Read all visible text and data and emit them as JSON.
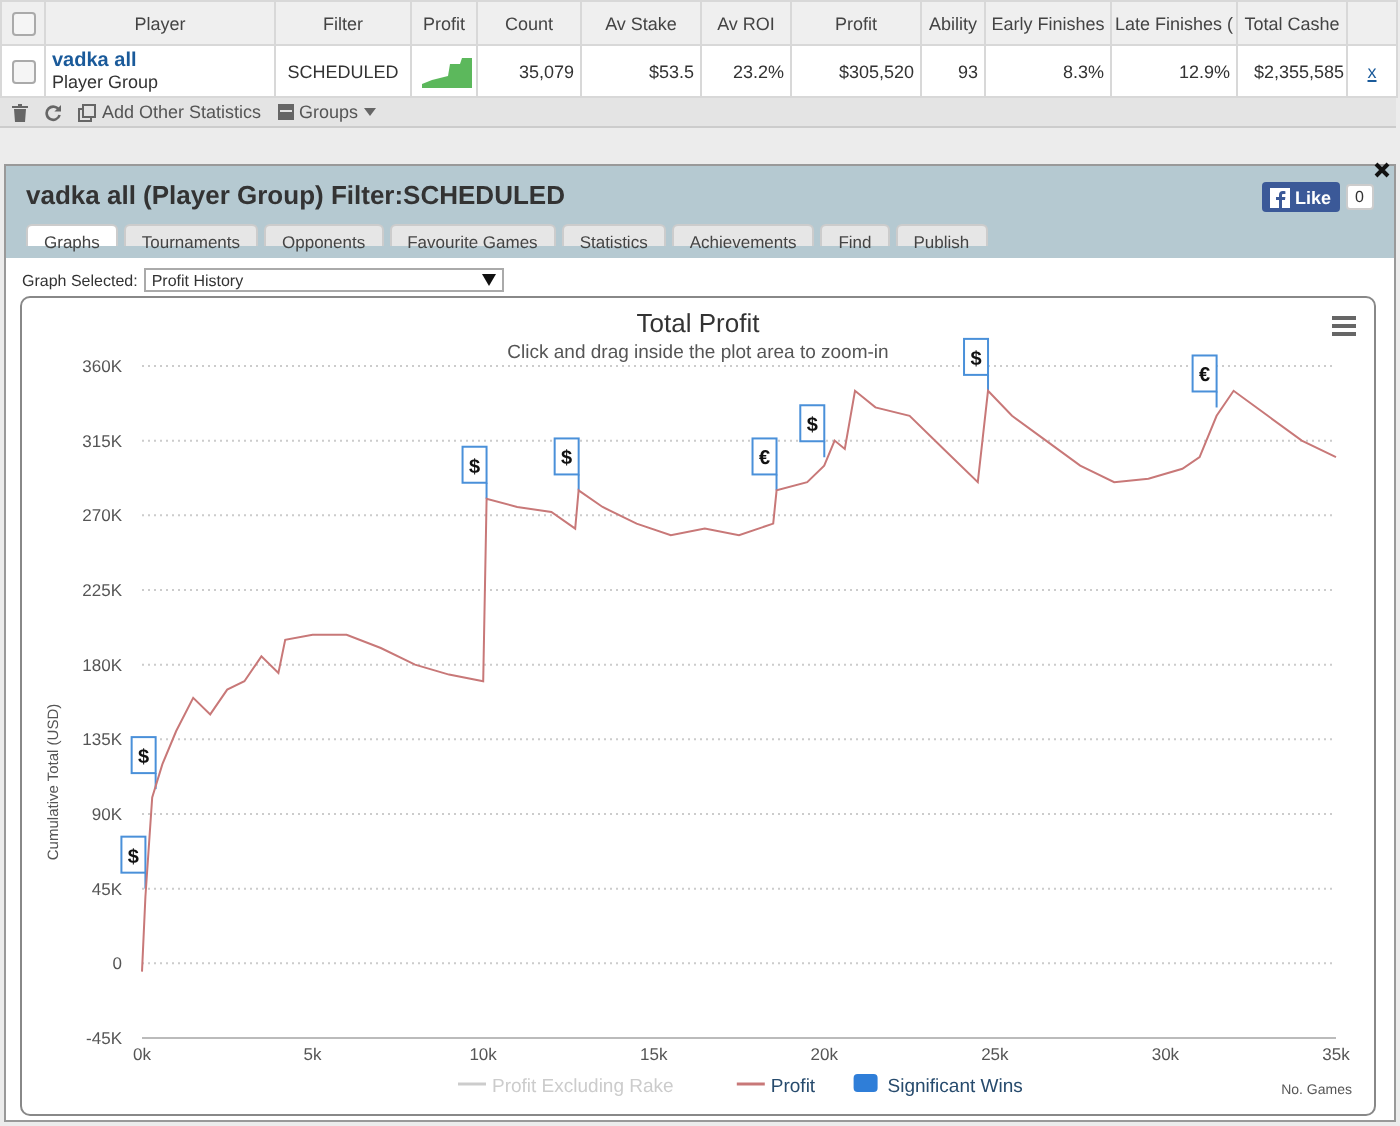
{
  "table": {
    "all_checked": false,
    "columns": [
      "Player",
      "Filter",
      "Profit",
      "Count",
      "Av Stake",
      "Av ROI",
      "Profit",
      "Ability",
      "Early Finishes",
      "Late Finishes (",
      "Total Cashe"
    ],
    "rows": [
      {
        "checked": false,
        "player": "vadka all",
        "player_type": "Player Group",
        "filter": "SCHEDULED",
        "count": "35,079",
        "av_stake": "$53.5",
        "av_roi": "23.2%",
        "profit": "$305,520",
        "ability": "93",
        "early_finishes": "8.3%",
        "late_finishes": "12.9%",
        "total_cashes": "$2,355,585",
        "remove": "x"
      }
    ]
  },
  "toolbar": {
    "items": [
      {
        "kind": "delete"
      },
      {
        "kind": "refresh"
      },
      {
        "kind": "add",
        "label": "Add Other Statistics"
      },
      {
        "kind": "groups",
        "label": "Groups"
      }
    ]
  },
  "panel": {
    "title": "vadka all (Player Group) Filter:SCHEDULED",
    "like": {
      "label": "Like",
      "count": "0"
    },
    "tabs": [
      {
        "label": "Graphs",
        "selected": true
      },
      {
        "label": "Tournaments",
        "selected": false
      },
      {
        "label": "Opponents",
        "selected": false
      },
      {
        "label": "Favourite Games",
        "selected": false
      },
      {
        "label": "Statistics",
        "selected": false
      },
      {
        "label": "Achievements",
        "selected": false
      },
      {
        "label": "Find",
        "selected": false
      },
      {
        "label": "Publish",
        "selected": false
      }
    ],
    "graph_select": {
      "label": "Graph Selected:",
      "value": "Profit History"
    },
    "chart": {
      "subtitle": "Click and drag inside the plot area to zoom-in",
      "legend": [
        {
          "label": "Profit Excluding Rake",
          "hidden": true,
          "color": "#cccccc",
          "kind": "line"
        },
        {
          "hidden": false,
          "kind": "series"
        },
        {
          "label": "Significant Wins",
          "hidden": false,
          "color": "#2f7ed8",
          "kind": "flag"
        }
      ],
      "chart_data": {
        "type": "line",
        "title": "Total Profit",
        "xlabel": "No. Games",
        "ylabel": "Cumulative Total (USD)",
        "x": [
          0,
          100,
          300,
          600,
          1000,
          1500,
          2000,
          2500,
          3000,
          3500,
          4000,
          4200,
          5000,
          6000,
          7000,
          8000,
          9000,
          10000,
          10100,
          11000,
          12000,
          12700,
          12800,
          13500,
          14500,
          15500,
          16500,
          17500,
          18500,
          18600,
          19500,
          20000,
          20300,
          20600,
          20900,
          21500,
          22500,
          23500,
          24500,
          24800,
          25500,
          26500,
          27500,
          28500,
          29500,
          30500,
          31000,
          31500,
          32000,
          33000,
          34000,
          35000
        ],
        "series": [
          {
            "name": "Profit",
            "color": "#c87878",
            "values": [
              -5,
              40,
              100,
              120,
              140,
              160,
              150,
              165,
              170,
              185,
              175,
              195,
              198,
              198,
              190,
              180,
              174,
              170,
              280,
              275,
              272,
              262,
              285,
              275,
              265,
              258,
              262,
              258,
              265,
              285,
              290,
              300,
              315,
              310,
              345,
              335,
              330,
              310,
              290,
              345,
              330,
              315,
              300,
              290,
              292,
              298,
              305,
              330,
              345,
              330,
              315,
              305
            ]
          }
        ],
        "grid": true,
        "xlim": [
          0,
          35000
        ],
        "ylim": [
          -45,
          360
        ],
        "xticks": [
          {
            "value": 0,
            "label": "0k"
          },
          {
            "value": 5000,
            "label": "5k"
          },
          {
            "value": 10000,
            "label": "10k"
          },
          {
            "value": 15000,
            "label": "15k"
          },
          {
            "value": 20000,
            "label": "20k"
          },
          {
            "value": 25000,
            "label": "25k"
          },
          {
            "value": 30000,
            "label": "30k"
          },
          {
            "value": 35000,
            "label": "35k"
          }
        ],
        "yticks": [
          {
            "value": -45,
            "label": "-45K"
          },
          {
            "value": 0,
            "label": "0"
          },
          {
            "value": 45,
            "label": "45K"
          },
          {
            "value": 90,
            "label": "90K"
          },
          {
            "value": 135,
            "label": "135K"
          },
          {
            "value": 180,
            "label": "180K"
          },
          {
            "value": 225,
            "label": "225K"
          },
          {
            "value": 270,
            "label": "270K"
          },
          {
            "value": 315,
            "label": "315K"
          },
          {
            "value": 360,
            "label": "360K"
          }
        ],
        "annotations": [
          {
            "x": 100,
            "y": 45,
            "text": "$"
          },
          {
            "x": 400,
            "y": 105,
            "text": "$"
          },
          {
            "x": 10100,
            "y": 280,
            "text": "$"
          },
          {
            "x": 12800,
            "y": 285,
            "text": "$"
          },
          {
            "x": 18600,
            "y": 285,
            "text": "€"
          },
          {
            "x": 20000,
            "y": 305,
            "text": "$"
          },
          {
            "x": 24800,
            "y": 345,
            "text": "$"
          },
          {
            "x": 31500,
            "y": 335,
            "text": "€"
          }
        ]
      }
    }
  }
}
